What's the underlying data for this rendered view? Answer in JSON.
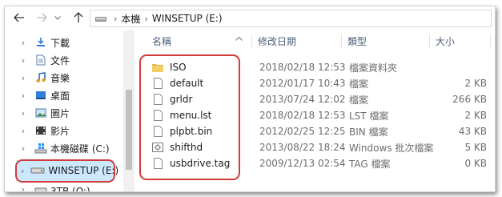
{
  "address": {
    "breadcrumbs": [
      "本機",
      "WINSETUP (E:)"
    ]
  },
  "nav": {
    "items": [
      {
        "label": "下載",
        "icon": "download-icon"
      },
      {
        "label": "文件",
        "icon": "document-icon"
      },
      {
        "label": "音樂",
        "icon": "music-icon"
      },
      {
        "label": "桌面",
        "icon": "desktop-icon"
      },
      {
        "label": "圖片",
        "icon": "picture-icon"
      },
      {
        "label": "影片",
        "icon": "video-icon"
      },
      {
        "label": "本機磁碟 (C:)",
        "icon": "windows-drive-icon"
      },
      {
        "label": "WINSETUP (E:)",
        "icon": "drive-icon",
        "selected": true
      },
      {
        "label": "3TB (O:)",
        "icon": "drive-icon"
      }
    ]
  },
  "columns": {
    "name": "名稱",
    "modified": "修改日期",
    "type": "類型",
    "size": "大小"
  },
  "files": [
    {
      "name": "ISO",
      "modified": "2018/02/18 12:53",
      "type": "檔案資料夾",
      "size": "",
      "icon": "folder-icon"
    },
    {
      "name": "default",
      "modified": "2012/01/17 10:43",
      "type": "檔案",
      "size": "2 KB",
      "icon": "file-icon"
    },
    {
      "name": "grldr",
      "modified": "2013/07/24 12:02",
      "type": "檔案",
      "size": "266 KB",
      "icon": "file-icon"
    },
    {
      "name": "menu.lst",
      "modified": "2018/02/18 12:53",
      "type": "LST 檔案",
      "size": "2 KB",
      "icon": "file-icon"
    },
    {
      "name": "plpbt.bin",
      "modified": "2012/02/25 12:25",
      "type": "BIN 檔案",
      "size": "43 KB",
      "icon": "file-icon"
    },
    {
      "name": "shifthd",
      "modified": "2013/08/22 18:24",
      "type": "Windows 批次檔案",
      "size": "5 KB",
      "icon": "batch-file-icon"
    },
    {
      "name": "usbdrive.tag",
      "modified": "2009/12/13 02:54",
      "type": "TAG 檔案",
      "size": "0 KB",
      "icon": "file-icon"
    }
  ],
  "colors": {
    "annotation": "#d23b3b",
    "selection": "#cce8ff",
    "header_text": "#4c607a",
    "folder": "#e8b84a"
  }
}
